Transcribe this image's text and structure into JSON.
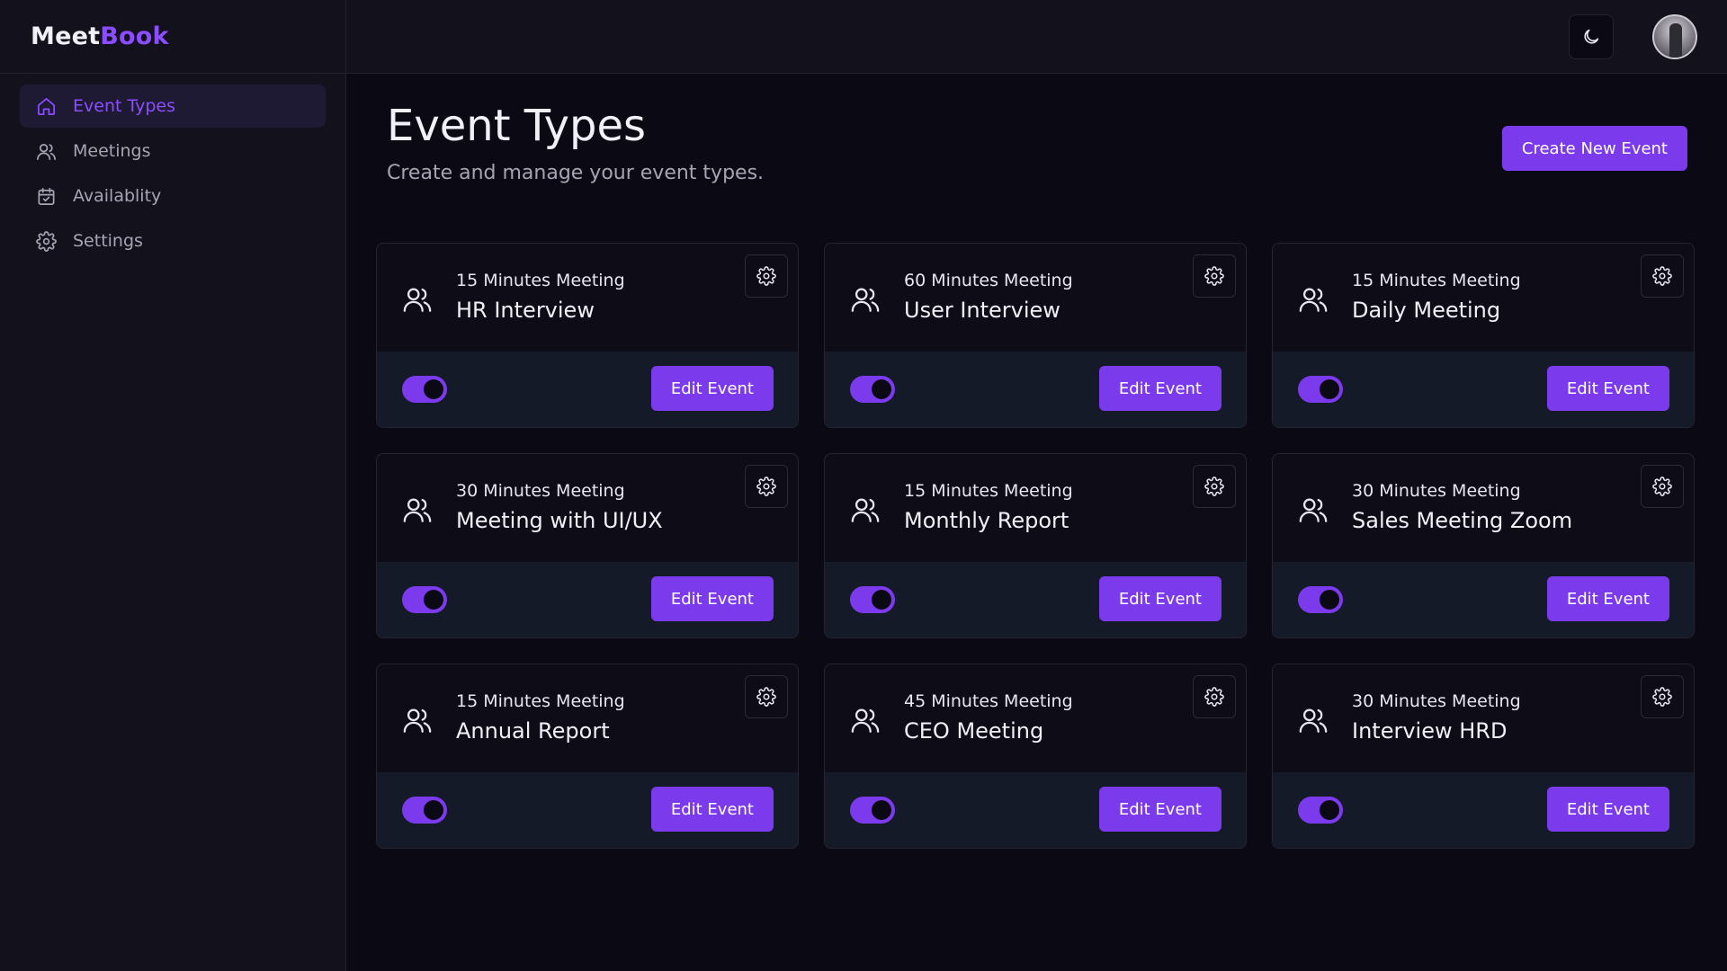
{
  "brand": {
    "part1": "Meet",
    "part2": "Book"
  },
  "sidebar": {
    "items": [
      {
        "label": "Event Types",
        "icon": "home-icon",
        "active": true
      },
      {
        "label": "Meetings",
        "icon": "users-icon",
        "active": false
      },
      {
        "label": "Availablity",
        "icon": "calendar-check-icon",
        "active": false
      },
      {
        "label": "Settings",
        "icon": "gear-icon",
        "active": false
      }
    ]
  },
  "topbar": {
    "theme_icon": "moon-icon",
    "avatar": "user-avatar"
  },
  "page": {
    "title": "Event Types",
    "subtitle": "Create and manage your event types.",
    "create_label": "Create New Event"
  },
  "events": [
    {
      "duration": "15 Minutes Meeting",
      "title": "HR Interview",
      "enabled": true,
      "edit_label": "Edit Event"
    },
    {
      "duration": "60 Minutes Meeting",
      "title": "User Interview",
      "enabled": true,
      "edit_label": "Edit Event"
    },
    {
      "duration": "15 Minutes Meeting",
      "title": "Daily Meeting",
      "enabled": true,
      "edit_label": "Edit Event"
    },
    {
      "duration": "30 Minutes Meeting",
      "title": "Meeting with UI/UX",
      "enabled": true,
      "edit_label": "Edit Event"
    },
    {
      "duration": "15 Minutes Meeting",
      "title": "Monthly Report",
      "enabled": true,
      "edit_label": "Edit Event"
    },
    {
      "duration": "30 Minutes Meeting",
      "title": "Sales Meeting Zoom",
      "enabled": true,
      "edit_label": "Edit Event"
    },
    {
      "duration": "15 Minutes Meeting",
      "title": "Annual Report",
      "enabled": true,
      "edit_label": "Edit Event"
    },
    {
      "duration": "45 Minutes Meeting",
      "title": "CEO Meeting",
      "enabled": true,
      "edit_label": "Edit Event"
    },
    {
      "duration": "30 Minutes Meeting",
      "title": "Interview HRD",
      "enabled": true,
      "edit_label": "Edit Event"
    }
  ],
  "colors": {
    "accent": "#7c3aed",
    "accent_text": "#8b4dff",
    "background": "#0b0a14",
    "sidebar": "#12111c",
    "card_footer": "#151a29"
  }
}
